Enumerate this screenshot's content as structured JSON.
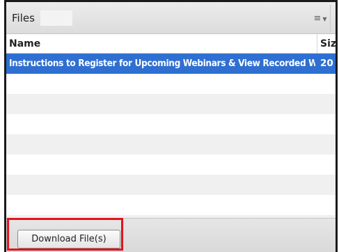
{
  "pod": {
    "title": "Files",
    "options_icon": "list-menu-icon"
  },
  "table": {
    "columns": [
      {
        "label": "Name"
      },
      {
        "label": "Siz"
      }
    ],
    "rows": [
      {
        "name": "Instructions to Register for Upcoming Webinars & View Recorded Web",
        "size": "20",
        "selected": true
      }
    ]
  },
  "footer": {
    "download_label": "Download File(s)"
  },
  "colors": {
    "selection": "#2e6fd1",
    "highlight_outline": "#e3121b"
  }
}
